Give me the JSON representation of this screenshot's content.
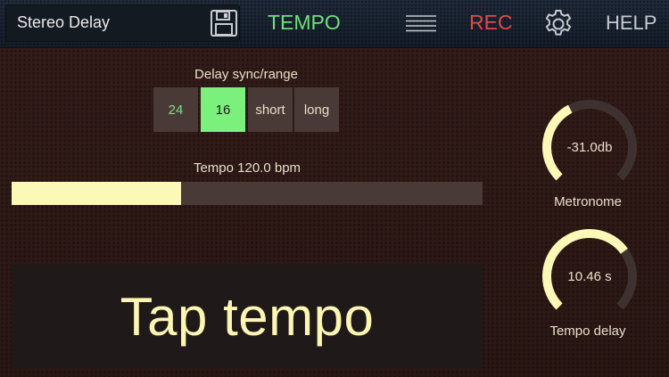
{
  "header": {
    "preset_name": "Stereo Delay",
    "tempo_tab": "TEMPO",
    "rec_label": "REC",
    "help_label": "HELP",
    "icons": {
      "save": "floppy-disk-icon",
      "menu": "menu-lines-icon",
      "settings": "gear-icon"
    }
  },
  "delay_sync": {
    "label": "Delay sync/range",
    "options": [
      "24",
      "16",
      "short",
      "long"
    ],
    "selected": "16"
  },
  "tempo": {
    "label": "Tempo 120.0 bpm",
    "fill_fraction": 0.36
  },
  "tap": {
    "label": "Tap tempo"
  },
  "knobs": {
    "metronome": {
      "value": "-31.0db",
      "label": "Metronome",
      "level": 0.4
    },
    "tempo_delay": {
      "value": "10.46 s",
      "label": "Tempo delay",
      "level": 0.7
    }
  },
  "colors": {
    "accent_green": "#7bf07c",
    "rec_red": "#e04848",
    "knob_fill": "#fcf8b8",
    "knob_track": "#3e3230"
  }
}
